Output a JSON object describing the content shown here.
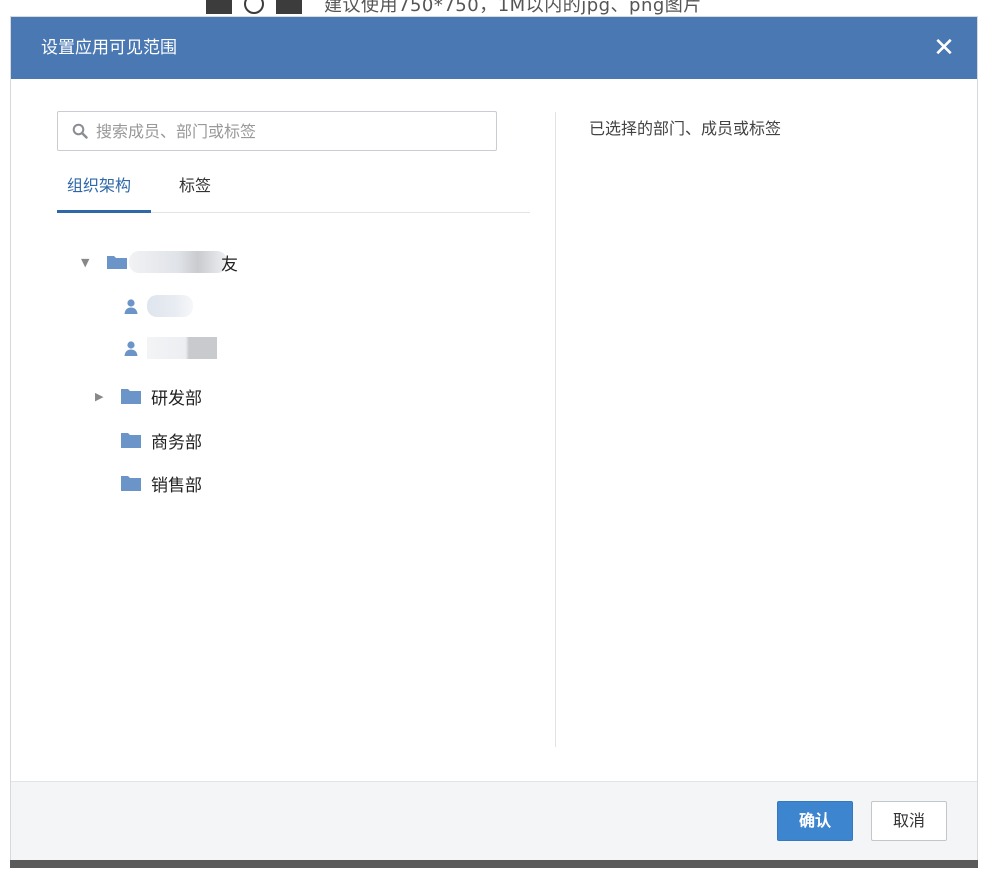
{
  "backdrop": {
    "hint_text": "建议使用750*750，1M以内的jpg、png图片"
  },
  "dialog": {
    "title": "设置应用可见范围",
    "close_glyph": "✕"
  },
  "search": {
    "placeholder": "搜索成员、部门或标签",
    "value": ""
  },
  "tabs": [
    {
      "label": "组织架构",
      "active": true
    },
    {
      "label": "标签",
      "active": false
    }
  ],
  "tree": {
    "root": {
      "label_suffix": "友",
      "expanded": true
    },
    "departments": [
      {
        "label": "研发部",
        "has_children": true
      },
      {
        "label": "商务部",
        "has_children": false
      },
      {
        "label": "销售部",
        "has_children": false
      }
    ]
  },
  "selected": {
    "title": "已选择的部门、成员或标签"
  },
  "footer": {
    "confirm_label": "确认",
    "cancel_label": "取消"
  },
  "colors": {
    "header": "#4a78b3",
    "accent": "#2e68a8",
    "confirm": "#3e85cf",
    "folder": "#6b95c8"
  }
}
